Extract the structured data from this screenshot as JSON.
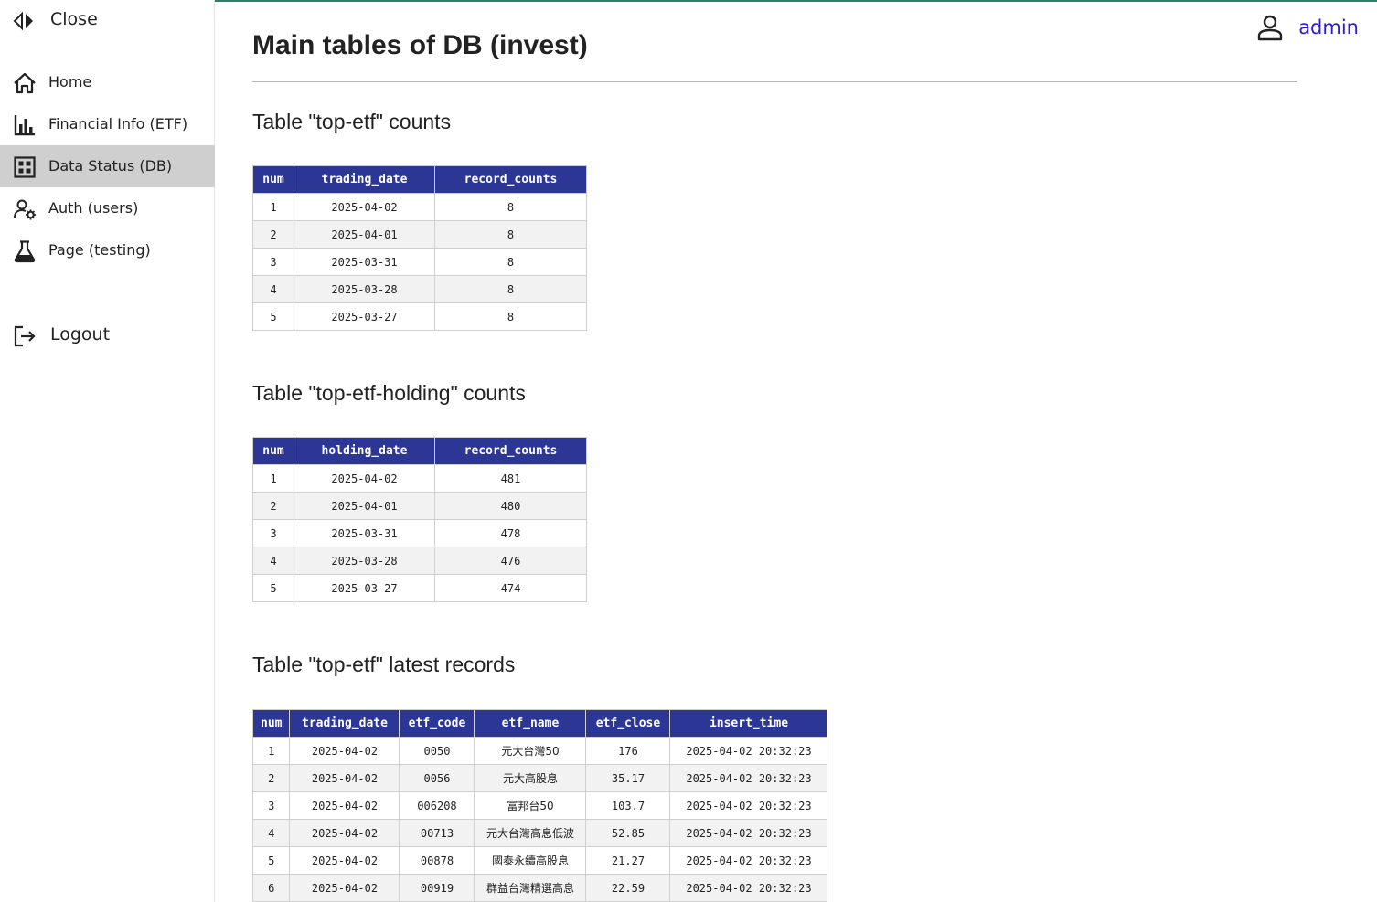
{
  "sidebar": {
    "close_label": "Close",
    "items": [
      {
        "label": "Home",
        "icon": "home-icon"
      },
      {
        "label": "Financial Info (ETF)",
        "icon": "bar-chart-icon"
      },
      {
        "label": "Data Status (DB)",
        "icon": "grid-icon",
        "active": true
      },
      {
        "label": "Auth (users)",
        "icon": "user-gear-icon"
      },
      {
        "label": "Page (testing)",
        "icon": "flask-icon"
      }
    ],
    "logout_label": "Logout"
  },
  "header": {
    "user_label": "admin",
    "accent_color": "#2a1bd6",
    "top_border_color": "#2f7d6d"
  },
  "main": {
    "title": "Main tables of DB (invest)",
    "sections": [
      {
        "title": "Table \"top-etf\" counts",
        "columns": [
          "num",
          "trading_date",
          "record_counts"
        ],
        "rows": [
          [
            "1",
            "2025-04-02",
            "8"
          ],
          [
            "2",
            "2025-04-01",
            "8"
          ],
          [
            "3",
            "2025-03-31",
            "8"
          ],
          [
            "4",
            "2025-03-28",
            "8"
          ],
          [
            "5",
            "2025-03-27",
            "8"
          ]
        ]
      },
      {
        "title": "Table \"top-etf-holding\" counts",
        "columns": [
          "num",
          "holding_date",
          "record_counts"
        ],
        "rows": [
          [
            "1",
            "2025-04-02",
            "481"
          ],
          [
            "2",
            "2025-04-01",
            "480"
          ],
          [
            "3",
            "2025-03-31",
            "478"
          ],
          [
            "4",
            "2025-03-28",
            "476"
          ],
          [
            "5",
            "2025-03-27",
            "474"
          ]
        ]
      },
      {
        "title": "Table \"top-etf\" latest records",
        "columns": [
          "num",
          "trading_date",
          "etf_code",
          "etf_name",
          "etf_close",
          "insert_time"
        ],
        "rows": [
          [
            "1",
            "2025-04-02",
            "0050",
            "元大台灣50",
            "176",
            "2025-04-02 20:32:23"
          ],
          [
            "2",
            "2025-04-02",
            "0056",
            "元大高股息",
            "35.17",
            "2025-04-02 20:32:23"
          ],
          [
            "3",
            "2025-04-02",
            "006208",
            "富邦台50",
            "103.7",
            "2025-04-02 20:32:23"
          ],
          [
            "4",
            "2025-04-02",
            "00713",
            "元大台灣高息低波",
            "52.85",
            "2025-04-02 20:32:23"
          ],
          [
            "5",
            "2025-04-02",
            "00878",
            "國泰永續高股息",
            "21.27",
            "2025-04-02 20:32:23"
          ],
          [
            "6",
            "2025-04-02",
            "00919",
            "群益台灣精選高息",
            "22.59",
            "2025-04-02 20:32:23"
          ]
        ]
      }
    ],
    "header_color": "#2c3694"
  }
}
